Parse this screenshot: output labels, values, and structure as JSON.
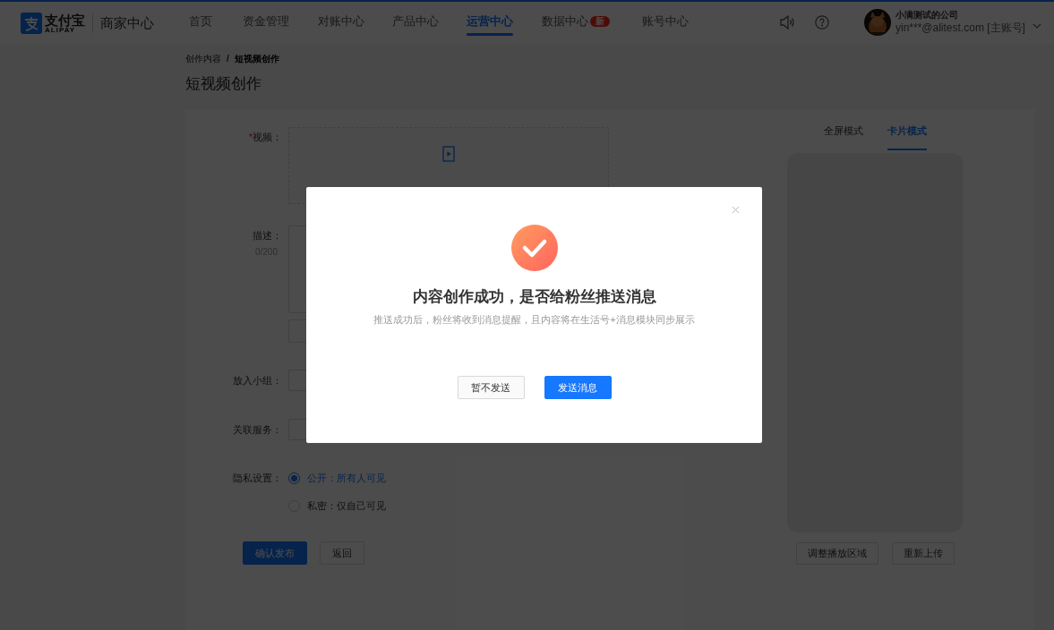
{
  "header": {
    "logo_text": "支付宝",
    "logo_sub": "ALIPAY",
    "product": "商家中心",
    "nav": [
      {
        "label": "首页",
        "selected": false
      },
      {
        "label": "资金管理",
        "selected": false
      },
      {
        "label": "对账中心",
        "selected": false
      },
      {
        "label": "产品中心",
        "selected": false
      },
      {
        "label": "运营中心",
        "selected": true
      },
      {
        "label": "数据中心",
        "selected": false,
        "badge": "新"
      },
      {
        "label": "账号中心",
        "selected": false
      }
    ],
    "account": {
      "company": "小满测试的公司",
      "email": "yin***@alitest.com [主账号]"
    }
  },
  "breadcrumb": {
    "items": [
      "创作内容",
      "短视频创作"
    ],
    "separator": "/"
  },
  "page_title": "短视频创作",
  "form": {
    "fields": [
      {
        "kind": "upload",
        "label": "视频：",
        "required_mark": "*"
      },
      {
        "kind": "textarea",
        "label": "描述：",
        "counter": "0/200"
      },
      {
        "kind": "select",
        "label": "放入小组："
      },
      {
        "kind": "select",
        "label": "关联服务："
      },
      {
        "kind": "radio",
        "label": "隐私设置：",
        "options": [
          {
            "label": "公开：所有人可见",
            "selected": true
          },
          {
            "label": "私密：仅自己可见",
            "selected": false
          }
        ]
      }
    ],
    "actions": [
      {
        "label": "确认发布",
        "kind": "primary"
      },
      {
        "label": "返回",
        "kind": "default"
      }
    ]
  },
  "preview": {
    "tabs": [
      {
        "label": "全屏模式",
        "selected": false
      },
      {
        "label": "卡片模式",
        "selected": true
      }
    ],
    "buttons": [
      "调整播放区域",
      "重新上传"
    ]
  },
  "dialog": {
    "title": "内容创作成功，是否给粉丝推送消息",
    "message": "推送成功后，粉丝将收到消息提醒，且内容将在生活号+消息模块同步展示",
    "buttons": [
      {
        "label": "暂不发送",
        "kind": "default"
      },
      {
        "label": "发送消息",
        "kind": "primary"
      }
    ]
  }
}
